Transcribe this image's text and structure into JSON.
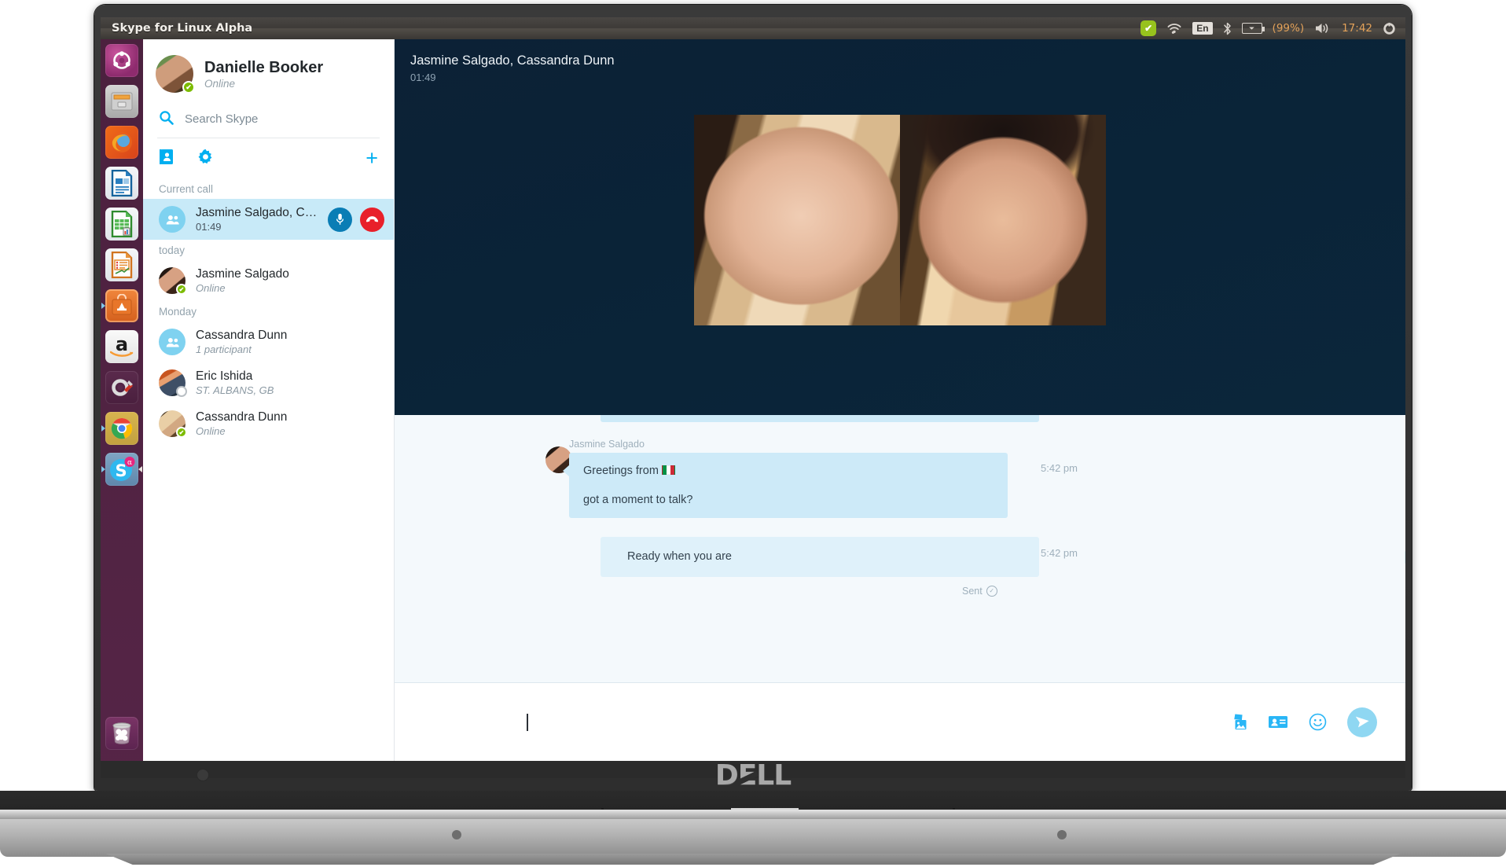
{
  "window": {
    "title": "Skype for Linux Alpha"
  },
  "system_panel": {
    "indicators": [
      {
        "name": "sync-check-icon",
        "label": "✔"
      },
      {
        "name": "wifi-icon",
        "label": "◓"
      },
      {
        "name": "keyboard-layout-indicator",
        "label": "En"
      },
      {
        "name": "bluetooth-icon",
        "label": "ᛦ"
      },
      {
        "name": "battery-icon",
        "label": "⚡"
      }
    ],
    "battery_percent": "(99%)",
    "volume_icon": "🔊",
    "clock": "17:42",
    "session_icon": "⚙"
  },
  "launcher": {
    "items": [
      {
        "name": "dash-home",
        "glyph": "◉",
        "cls": "li-ubuntu",
        "running": false,
        "focused": false
      },
      {
        "name": "files",
        "glyph": "⌸",
        "cls": "li-files",
        "running": false,
        "focused": false
      },
      {
        "name": "firefox",
        "glyph": "",
        "cls": "li-firefox",
        "running": false,
        "focused": false
      },
      {
        "name": "libreoffice-writer",
        "glyph": "☰",
        "cls": "li-writer",
        "running": false,
        "focused": false
      },
      {
        "name": "libreoffice-calc",
        "glyph": "▦",
        "cls": "li-calc",
        "running": false,
        "focused": false
      },
      {
        "name": "libreoffice-impress",
        "glyph": "▤",
        "cls": "li-impress",
        "running": false,
        "focused": false
      },
      {
        "name": "ubuntu-software",
        "glyph": "A",
        "cls": "li-software",
        "running": true,
        "focused": false
      },
      {
        "name": "amazon",
        "glyph": "a",
        "cls": "li-amazon",
        "running": false,
        "focused": false
      },
      {
        "name": "system-settings",
        "glyph": "⚙",
        "cls": "li-settings",
        "running": false,
        "focused": false
      },
      {
        "name": "google-chrome",
        "glyph": "●",
        "cls": "li-chrome",
        "running": true,
        "focused": false
      },
      {
        "name": "skype",
        "glyph": "S",
        "cls": "li-skype",
        "running": true,
        "focused": true
      }
    ],
    "trash": {
      "name": "trash",
      "glyph": "🗑",
      "cls": "li-trash"
    }
  },
  "sidebar": {
    "profile": {
      "name": "Danielle Booker",
      "status": "Online",
      "presence": "online"
    },
    "search": {
      "placeholder": "Search Skype",
      "value": "",
      "icon": "search-icon"
    },
    "tools": [
      {
        "name": "contacts-book-button",
        "glyph": "☰"
      },
      {
        "name": "settings-gear-button",
        "glyph": "⚙"
      }
    ],
    "add_button": {
      "name": "new-conversation-button",
      "glyph": "+"
    },
    "groups": [
      {
        "label": "Current call",
        "items": [
          {
            "name": "Jasmine Salgado, Ca...",
            "sub": "01:49",
            "avatar_type": "group",
            "active": true,
            "presence": "none",
            "actions": [
              {
                "name": "mute-microphone-button",
                "glyph": "•",
                "kind": "mic"
              },
              {
                "name": "end-call-button",
                "glyph": "⌕",
                "kind": "end"
              }
            ]
          }
        ]
      },
      {
        "label": "today",
        "items": [
          {
            "name": "Jasmine Salgado",
            "sub": "Online",
            "avatar_type": "photo-jas",
            "active": false,
            "presence": "online"
          }
        ]
      },
      {
        "label": "Monday",
        "items": [
          {
            "name": "Cassandra Dunn",
            "sub": "1 participant",
            "avatar_type": "group",
            "active": false,
            "presence": "none"
          },
          {
            "name": "Eric Ishida",
            "sub": "ST. ALBANS, GB",
            "avatar_type": "photo-eric",
            "active": false,
            "presence": "offline"
          },
          {
            "name": "Cassandra Dunn",
            "sub": "Online",
            "avatar_type": "photo-cass",
            "active": false,
            "presence": "online"
          }
        ]
      }
    ]
  },
  "call": {
    "title": "Jasmine Salgado, Cassandra Dunn",
    "duration": "01:49",
    "participants": [
      {
        "name": "cassandra-dunn-video-tile"
      },
      {
        "name": "jasmine-salgado-video-tile"
      }
    ]
  },
  "chat": {
    "messages": [
      {
        "sender": "Jasmine Salgado",
        "direction": "in",
        "lines": [
          "Greetings from ",
          "got a moment to talk?"
        ],
        "has_flag": true,
        "flag": "it",
        "time": "5:42 pm",
        "receipt": ""
      },
      {
        "sender": "",
        "direction": "out",
        "lines": [
          "Ready when you are"
        ],
        "has_flag": false,
        "flag": "",
        "time": "5:42 pm",
        "receipt": "Sent"
      }
    ]
  },
  "composer": {
    "value": "",
    "placeholder": "",
    "icons": [
      {
        "name": "send-image-button",
        "glyph": "🖼"
      },
      {
        "name": "send-contact-button",
        "glyph": "📇"
      },
      {
        "name": "emoticon-button",
        "glyph": "☺"
      }
    ],
    "send_button": {
      "name": "send-message-button",
      "glyph": "➤"
    }
  },
  "hardware": {
    "brand": "DELL"
  },
  "colors": {
    "skype_blue": "#00aff0",
    "accent_light": "#8fd7f2",
    "bubble_in": "#cdeaf8",
    "bubble_out": "#dff1fa",
    "presence_online": "#7cbb00",
    "end_call_red": "#e8202a",
    "mic_blue": "#0a7db5",
    "panel_dark": "#3d3a37",
    "video_bg": "#0b263b"
  }
}
